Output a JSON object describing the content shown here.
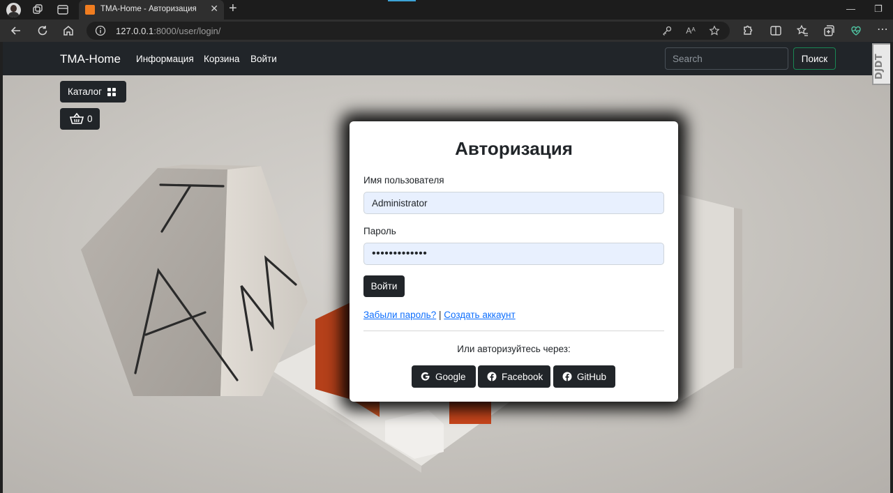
{
  "browser": {
    "tab_title": "TMA-Home - Авторизация",
    "url_host": "127.0.0.1",
    "url_rest": ":8000/user/login/",
    "read_aloud": "Aᴬ"
  },
  "navbar": {
    "brand": "TMA-Home",
    "links": [
      "Информация",
      "Корзина",
      "Войти"
    ],
    "search_placeholder": "Search",
    "search_button": "Поиск",
    "debug_toolbar": "DJDT"
  },
  "sidebar": {
    "catalog_label": "Каталог",
    "cart_count": "0"
  },
  "login": {
    "title": "Авторизация",
    "username_label": "Имя пользователя",
    "username_value": "Administrator",
    "password_label": "Пароль",
    "password_value": "•••••••••••••",
    "submit_label": "Войти",
    "forgot_link": "Забыли пароль?",
    "link_separator": "|",
    "register_link": "Создать аккаунт",
    "alt_text": "Или авторизуйтесь через:",
    "providers": [
      {
        "label": "Google",
        "icon": "google-icon"
      },
      {
        "label": "Facebook",
        "icon": "facebook-icon"
      },
      {
        "label": "GitHub",
        "icon": "github-icon"
      }
    ]
  },
  "colors": {
    "navbar_bg": "#212529",
    "button_dark": "#212529",
    "search_border": "#198754",
    "link": "#0d6efd",
    "input_autofill": "#e8f0fe",
    "accent_orange": "#c8431a"
  }
}
